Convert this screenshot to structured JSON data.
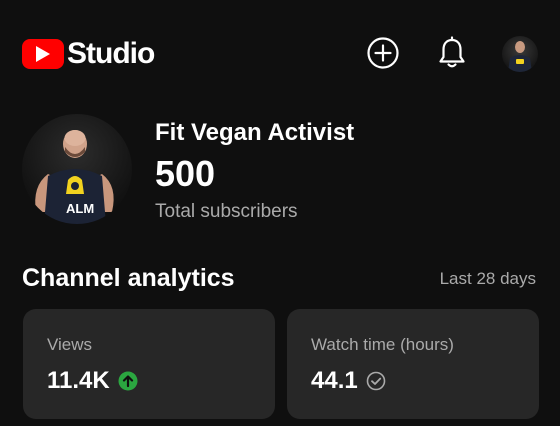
{
  "app": {
    "brand": "Studio",
    "icons": {
      "logo": "youtube-play-icon",
      "create": "plus-circle-icon",
      "notifications": "bell-icon",
      "account": "avatar"
    },
    "colors": {
      "background": "#0f0f0f",
      "brand_red": "#ff0000",
      "card": "#272727",
      "secondary_text": "#aaaaaa",
      "positive": "#2ba640"
    }
  },
  "channel": {
    "name": "Fit Vegan Activist",
    "subscriber_count": "500",
    "subscriber_label": "Total subscribers",
    "avatar_shirt_text": "ALM"
  },
  "analytics": {
    "title": "Channel analytics",
    "period": "Last 28 days",
    "cards": [
      {
        "label": "Views",
        "value": "11.4K",
        "status_icon": "arrow-up-circle-icon"
      },
      {
        "label": "Watch time (hours)",
        "value": "44.1",
        "status_icon": "check-circle-icon"
      }
    ]
  }
}
